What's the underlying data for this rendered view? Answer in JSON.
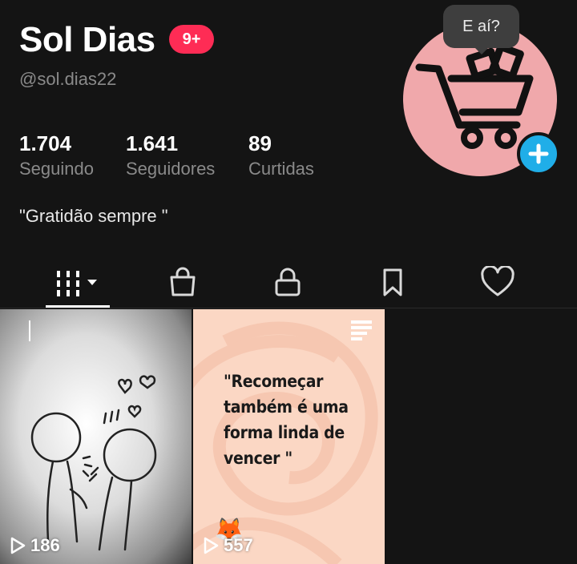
{
  "profile": {
    "name": "Sol Dias",
    "notification_badge": "9+",
    "handle": "@sol.dias22",
    "bio": "\"Gratidão sempre \"",
    "avatar_icon": "shopping-cart-icon"
  },
  "stats": [
    {
      "value": "1.704",
      "label": "Seguindo"
    },
    {
      "value": "1.641",
      "label": "Seguidores"
    },
    {
      "value": "89",
      "label": "Curtidas"
    }
  ],
  "tooltip": "E aí?",
  "tabs": [
    {
      "icon": "grid-icon",
      "selected": true
    },
    {
      "icon": "shopping-bag-icon",
      "selected": false
    },
    {
      "icon": "lock-icon",
      "selected": false
    },
    {
      "icon": "bookmark-icon",
      "selected": false
    },
    {
      "icon": "heart-icon",
      "selected": false
    }
  ],
  "videos": [
    {
      "views": "186",
      "thumbnail": "stick-figures-illustration"
    },
    {
      "views": "557",
      "caption": "\"Recomeçar também é uma forma linda de vencer \"",
      "emoji": "🦊"
    }
  ],
  "colors": {
    "background": "#141414",
    "badge": "#fe2c55",
    "plus_button": "#20aee8",
    "avatar_bg": "#f0a8ab",
    "secondary_text": "#8a8a8a"
  }
}
